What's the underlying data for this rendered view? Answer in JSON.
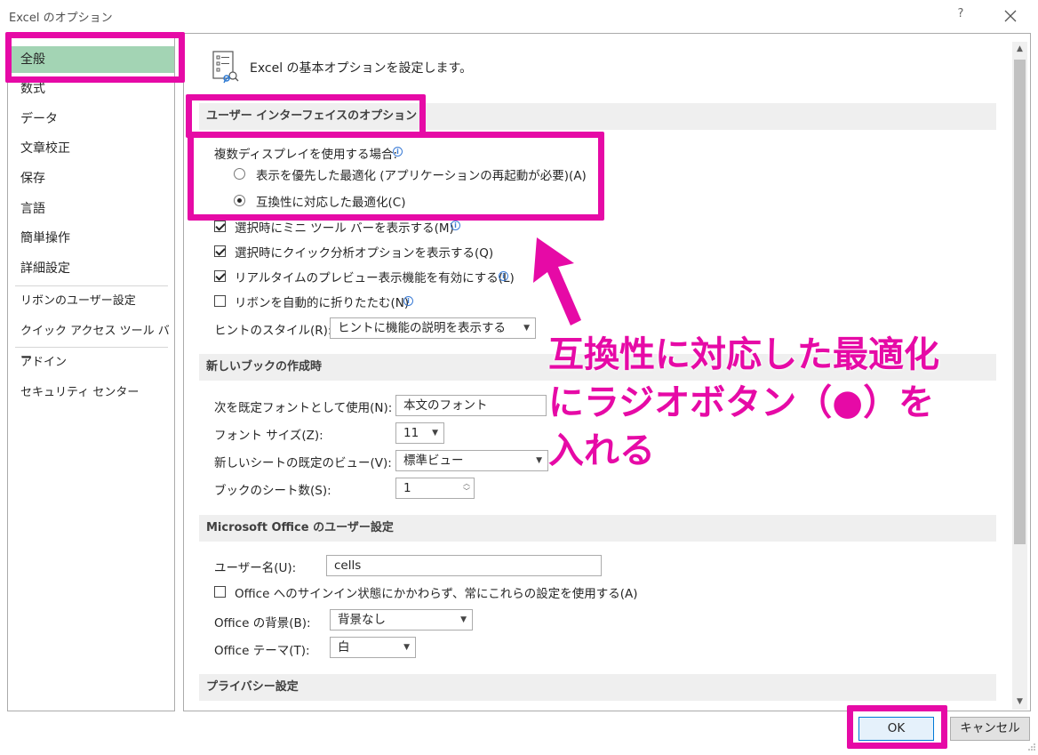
{
  "window": {
    "title": "Excel のオプション",
    "help": "?",
    "close_icon": "close-icon"
  },
  "sidebar": {
    "items": [
      {
        "label": "全般",
        "selected": true
      },
      {
        "label": "数式"
      },
      {
        "label": "データ"
      },
      {
        "label": "文章校正"
      },
      {
        "label": "保存"
      },
      {
        "label": "言語"
      },
      {
        "label": "簡単操作"
      },
      {
        "label": "詳細設定"
      },
      {
        "label": "リボンのユーザー設定"
      },
      {
        "label": "クイック アクセス ツール バー"
      },
      {
        "label": "アドイン"
      },
      {
        "label": "セキュリティ センター"
      }
    ]
  },
  "header": {
    "icon": "options-general-icon",
    "text": "Excel の基本オプションを設定します。"
  },
  "sections": {
    "ui": "ユーザー インターフェイスのオプション",
    "new_book": "新しいブックの作成時",
    "office_user": "Microsoft Office のユーザー設定",
    "privacy": "プライバシー設定"
  },
  "ui_options": {
    "multi_display_label": "複数ディスプレイを使用する場合:",
    "radio_display": "表示を優先した最適化 (アプリケーションの再起動が必要)(A)",
    "radio_compat": "互換性に対応した最適化(C)",
    "radio_selected": "compat",
    "mini_toolbar": "選択時にミニ ツール バーを表示する(M)",
    "quick_analysis": "選択時にクイック分析オプションを表示する(Q)",
    "live_preview": "リアルタイムのプレビュー表示機能を有効にする(L)",
    "collapse_ribbon": "リボンを自動的に折りたたむ(N)",
    "checked": {
      "mini_toolbar": true,
      "quick_analysis": true,
      "live_preview": true,
      "collapse_ribbon": false
    },
    "tooltip_style_label": "ヒントのスタイル(R):",
    "tooltip_style_value": "ヒントに機能の説明を表示する"
  },
  "new_book": {
    "font_label": "次を既定フォントとして使用(N):",
    "font_value": "本文のフォント",
    "size_label": "フォント サイズ(Z):",
    "size_value": "11",
    "view_label": "新しいシートの既定のビュー(V):",
    "view_value": "標準ビュー",
    "sheets_label": "ブックのシート数(S):",
    "sheets_value": "1"
  },
  "office_user": {
    "username_label": "ユーザー名(U):",
    "username_value": "cells",
    "always_use": "Office へのサインイン状態にかかわらず、常にこれらの設定を使用する(A)",
    "always_use_checked": false,
    "background_label": "Office の背景(B):",
    "background_value": "背景なし",
    "theme_label": "Office テーマ(T):",
    "theme_value": "白"
  },
  "annotation": {
    "line1": "互換性に対応した最適化",
    "line2": "にラジオボタン（●）を",
    "line3": "入れる",
    "color": "#e60aa6"
  },
  "buttons": {
    "ok": "OK",
    "cancel": "キャンセル"
  }
}
